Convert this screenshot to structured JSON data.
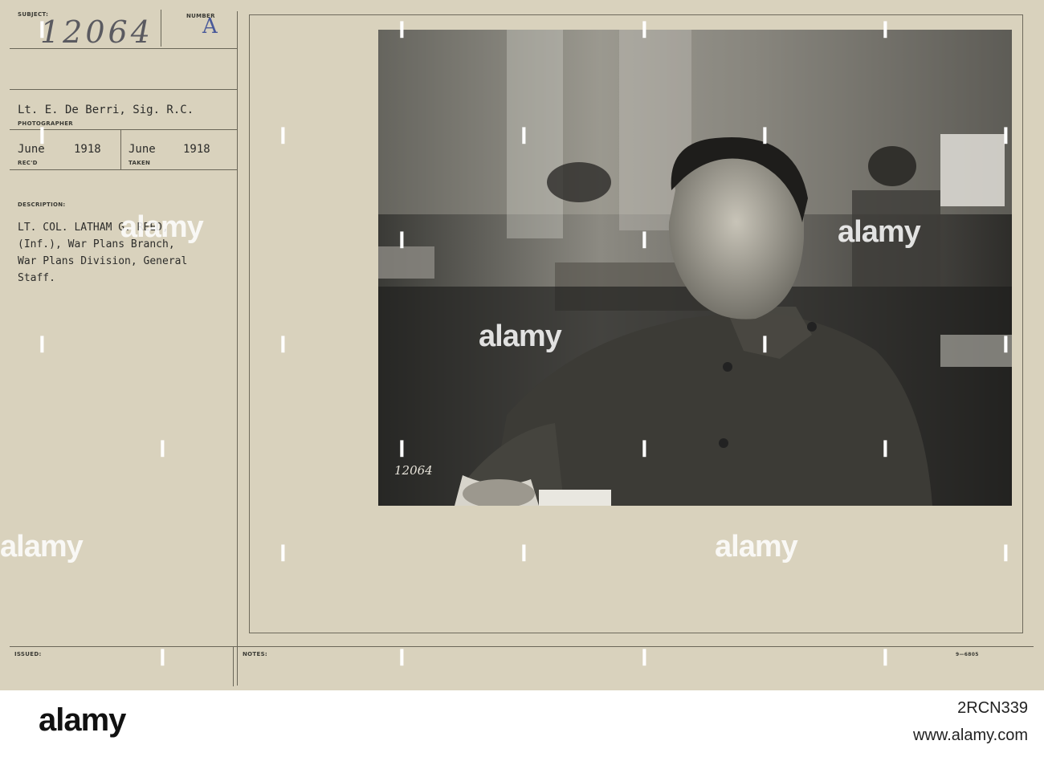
{
  "card": {
    "subject_label": "SUBJECT:",
    "subject_number": "12064",
    "number_label": "NUMBER",
    "number_letter": "A",
    "photographer": "Lt. E. De Berri, Sig. R.C.",
    "photographer_label": "PHOTOGRAPHER",
    "received_month": "June",
    "received_year": "1918",
    "received_label": "REC'D",
    "taken_month": "June",
    "taken_year": "1918",
    "taken_label": "TAKEN",
    "description_label": "DESCRIPTION:",
    "description_line1": "LT. COL. LATHAM G. REED,",
    "description_line2": "(Inf.), War Plans Branch,",
    "description_line3": "War Plans Division, General",
    "description_line4": "Staff.",
    "issued_label": "ISSUED:",
    "notes_label": "NOTES:",
    "form_code": "9—6805",
    "photo_stamp": "12064"
  },
  "watermark": {
    "text": "alamy"
  },
  "footer": {
    "logo": "alamy",
    "image_id": "2RCN339",
    "url": "www.alamy.com"
  },
  "colors": {
    "card_background": "#d9d2bd",
    "ink": "#2c2c2a",
    "rule": "#6a6658",
    "footer_background": "#ffffff"
  }
}
